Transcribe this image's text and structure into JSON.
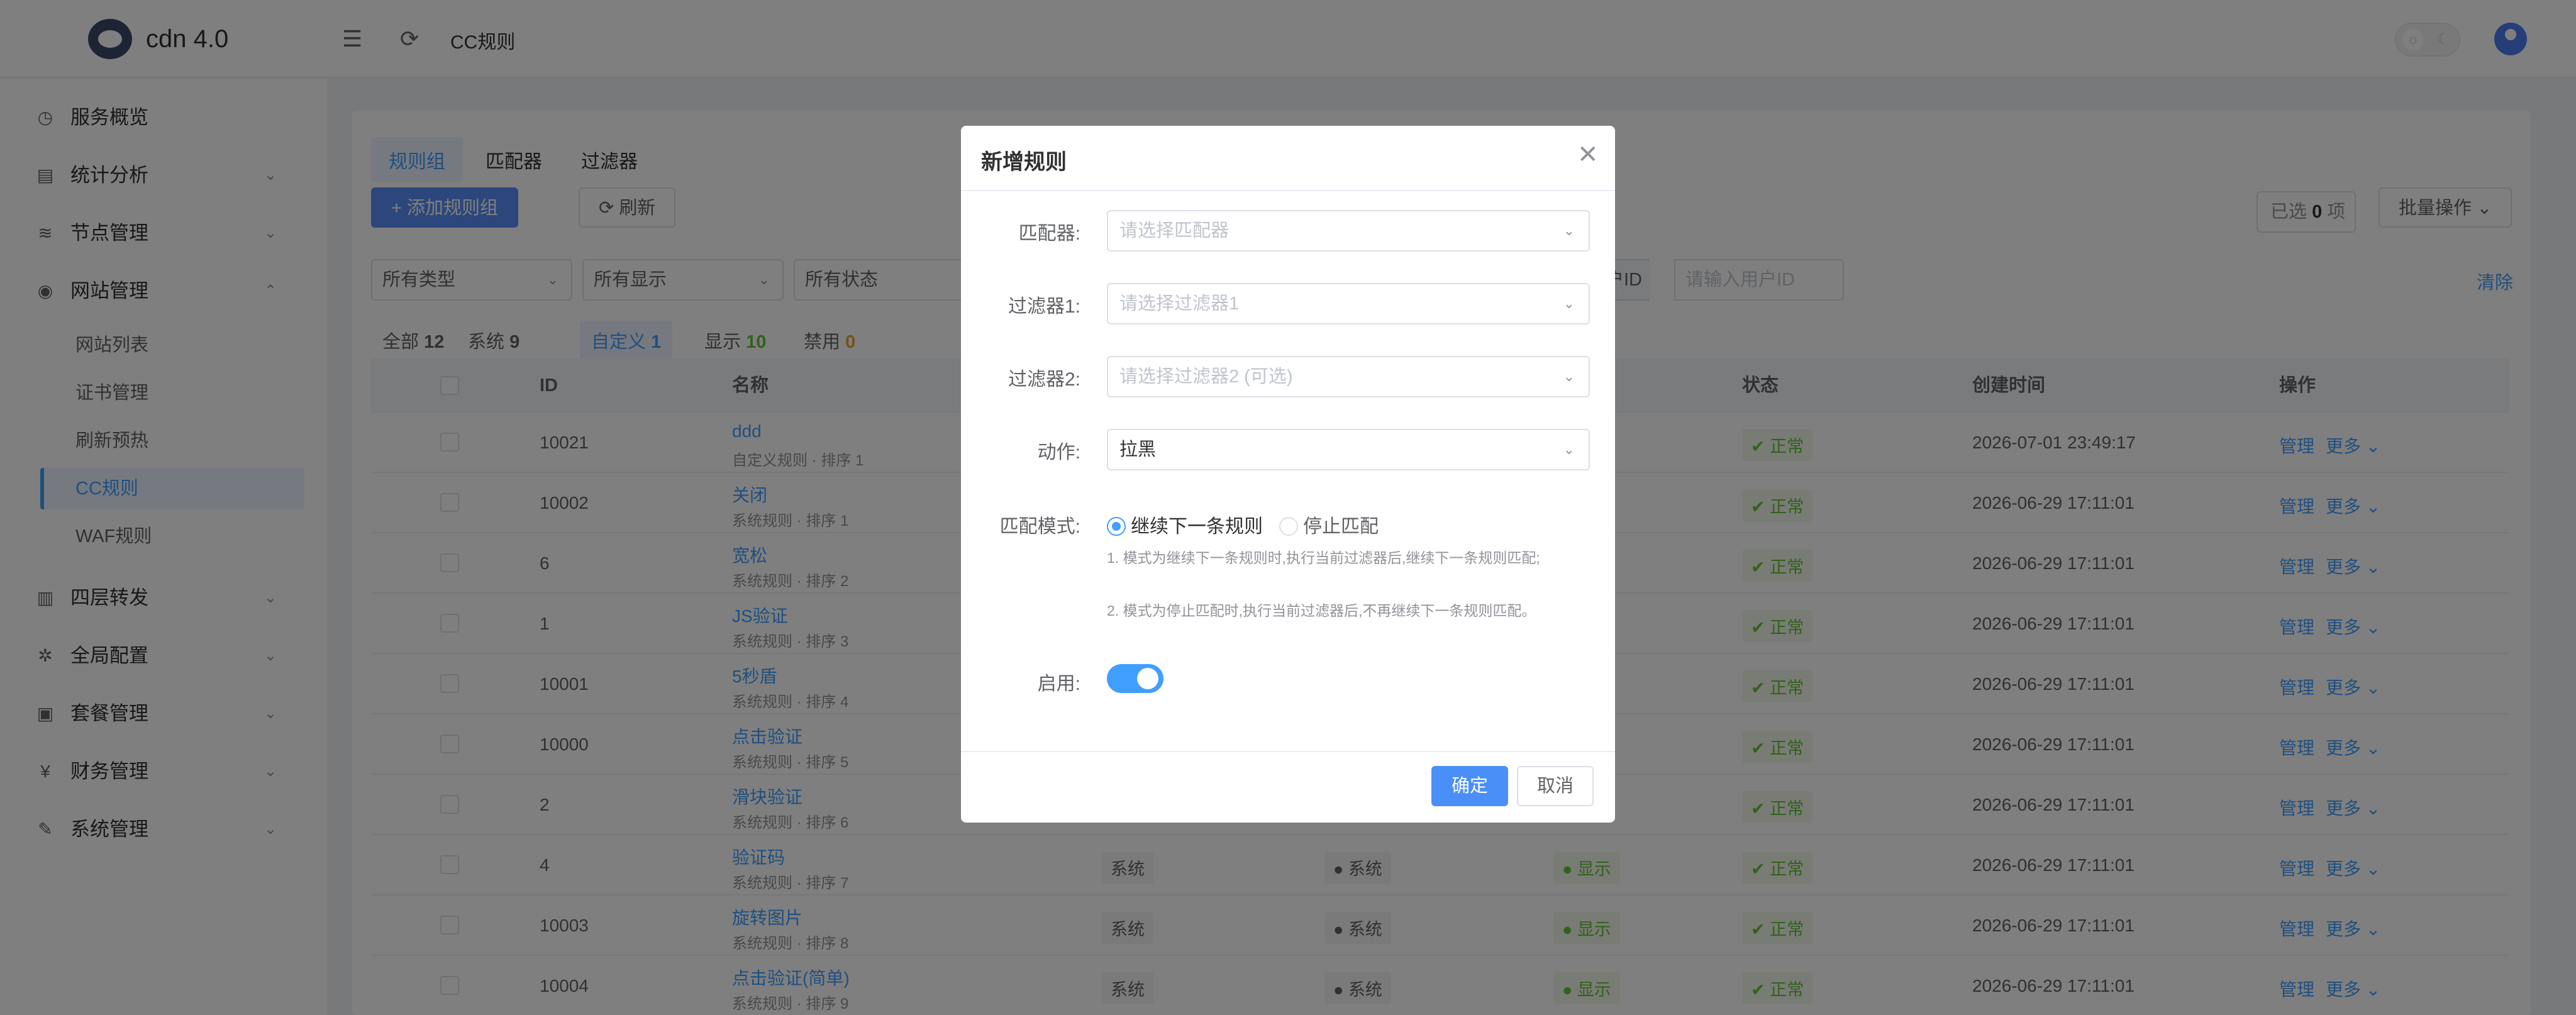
{
  "header": {
    "brand": "cdn 4.0",
    "breadcrumb": "CC规则",
    "menu_icon": "menu-fold-icon",
    "refresh_icon": "refresh-icon"
  },
  "sidebar": {
    "items": [
      {
        "label": "服务概览",
        "icon": "dashboard-icon"
      },
      {
        "label": "统计分析",
        "icon": "chart-icon"
      },
      {
        "label": "节点管理",
        "icon": "layers-icon"
      },
      {
        "label": "网站管理",
        "icon": "globe-icon"
      },
      {
        "label": "四层转发",
        "icon": "server-icon"
      },
      {
        "label": "全局配置",
        "icon": "gear-icon"
      },
      {
        "label": "套餐管理",
        "icon": "package-icon"
      },
      {
        "label": "财务管理",
        "icon": "yen-icon"
      },
      {
        "label": "系统管理",
        "icon": "wrench-icon"
      }
    ],
    "sub_items": [
      "网站列表",
      "证书管理",
      "刷新预热",
      "CC规则",
      "WAF规则"
    ]
  },
  "main": {
    "tabs": [
      "规则组",
      "匹配器",
      "过滤器"
    ],
    "add_button": "+ 添加规则组",
    "refresh_button": "刷新",
    "selected_prefix": "已选",
    "selected_count": "0",
    "selected_suffix": "项",
    "batch_button": "批量操作",
    "filters": [
      "所有类型",
      "所有显示",
      "所有状态"
    ],
    "uid_label": "用户ID",
    "uid_placeholder": "请输入用户ID",
    "clear": "清除",
    "stats": [
      {
        "label": "全部",
        "count": "12"
      },
      {
        "label": "系统",
        "count": "9"
      },
      {
        "label": "自定义",
        "count": "1"
      },
      {
        "label": "显示",
        "count": "10"
      },
      {
        "label": "禁用",
        "count": "0"
      }
    ],
    "columns": [
      "ID",
      "名称",
      "状态",
      "创建时间",
      "操作"
    ],
    "manage_label": "管理",
    "more_label": "更多",
    "rows": [
      {
        "id": "10021",
        "name": "ddd",
        "sub": "自定义规则 · 排序 1",
        "status": "正常",
        "time": "2026-07-01 23:49:17"
      },
      {
        "id": "10002",
        "name": "关闭",
        "sub": "系统规则 · 排序 1",
        "status": "正常",
        "time": "2026-06-29 17:11:01"
      },
      {
        "id": "6",
        "name": "宽松",
        "sub": "系统规则 · 排序 2",
        "status": "正常",
        "time": "2026-06-29 17:11:01"
      },
      {
        "id": "1",
        "name": "JS验证",
        "sub": "系统规则 · 排序 3",
        "status": "正常",
        "time": "2026-06-29 17:11:01"
      },
      {
        "id": "10001",
        "name": "5秒盾",
        "sub": "系统规则 · 排序 4",
        "status": "正常",
        "time": "2026-06-29 17:11:01"
      },
      {
        "id": "10000",
        "name": "点击验证",
        "sub": "系统规则 · 排序 5",
        "status": "正常",
        "time": "2026-06-29 17:11:01"
      },
      {
        "id": "2",
        "name": "滑块验证",
        "sub": "系统规则 · 排序 6",
        "status": "正常",
        "time": "2026-06-29 17:11:01"
      },
      {
        "id": "4",
        "name": "验证码",
        "sub": "系统规则 · 排序 7",
        "type": "系统",
        "source": "系统",
        "display": "显示",
        "status": "正常",
        "time": "2026-06-29 17:11:01"
      },
      {
        "id": "10003",
        "name": "旋转图片",
        "sub": "系统规则 · 排序 8",
        "type": "系统",
        "source": "系统",
        "display": "显示",
        "status": "正常",
        "time": "2026-06-29 17:11:01"
      },
      {
        "id": "10004",
        "name": "点击验证(简单)",
        "sub": "系统规则 · 排序 9",
        "type": "系统",
        "source": "系统",
        "display": "显示",
        "status": "正常",
        "time": "2026-06-29 17:11:01"
      }
    ]
  },
  "modal": {
    "title": "新增规则",
    "matcher_label": "匹配器:",
    "matcher_placeholder": "请选择匹配器",
    "filter1_label": "过滤器1:",
    "filter1_placeholder": "请选择过滤器1",
    "filter2_label": "过滤器2:",
    "filter2_placeholder": "请选择过滤器2 (可选)",
    "action_label": "动作:",
    "action_value": "拉黑",
    "mode_label": "匹配模式:",
    "mode_options": [
      "继续下一条规则",
      "停止匹配"
    ],
    "mode_selected": 0,
    "help_1": "1. 模式为继续下一条规则时,执行当前过滤器后,继续下一条规则匹配;",
    "help_2": "2. 模式为停止匹配时,执行当前过滤器后,不再继续下一条规则匹配。",
    "enable_label": "启用:",
    "enabled": true,
    "confirm": "确定",
    "cancel": "取消"
  }
}
